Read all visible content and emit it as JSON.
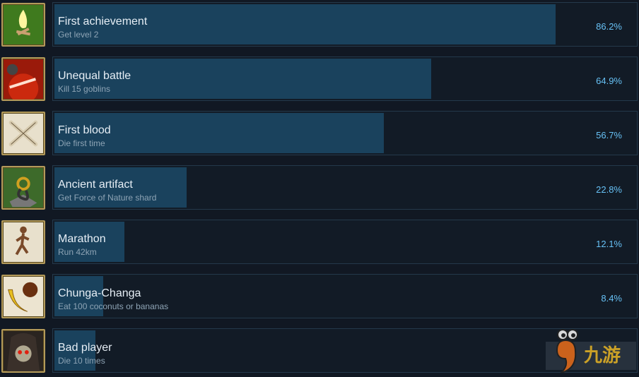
{
  "achievements": [
    {
      "title": "First achievement",
      "description": "Get level 2",
      "percent": "86.2%",
      "value": 86.2,
      "icon": "campfire-icon",
      "colors": [
        "#3f7a1e",
        "#f5f070"
      ]
    },
    {
      "title": "Unequal battle",
      "description": "Kill 15 goblins",
      "percent": "64.9%",
      "value": 64.9,
      "icon": "sword-icon",
      "colors": [
        "#9a1a0a",
        "#ff6040"
      ]
    },
    {
      "title": "First blood",
      "description": "Die first time",
      "percent": "56.7%",
      "value": 56.7,
      "icon": "crossbones-icon",
      "colors": [
        "#e8e0cc",
        "#6b5a40"
      ]
    },
    {
      "title": "Ancient artifact",
      "description": "Get Force of Nature shard",
      "percent": "22.8%",
      "value": 22.8,
      "icon": "artifact-icon",
      "colors": [
        "#3d6a2a",
        "#d0a020"
      ]
    },
    {
      "title": "Marathon",
      "description": "Run 42km",
      "percent": "12.1%",
      "value": 12.1,
      "icon": "runner-icon",
      "colors": [
        "#e8e0cc",
        "#7a4a2a"
      ]
    },
    {
      "title": "Chunga-Changa",
      "description": "Eat 100 coconuts or bananas",
      "percent": "8.4%",
      "value": 8.4,
      "icon": "banana-coconut-icon",
      "colors": [
        "#ece4d0",
        "#e8c020"
      ]
    },
    {
      "title": "Bad player",
      "description": "Die 10 times",
      "percent": "",
      "value": 7,
      "icon": "skull-icon",
      "colors": [
        "#2a2420",
        "#c03020"
      ]
    }
  ],
  "watermark": {
    "text": "九游"
  }
}
